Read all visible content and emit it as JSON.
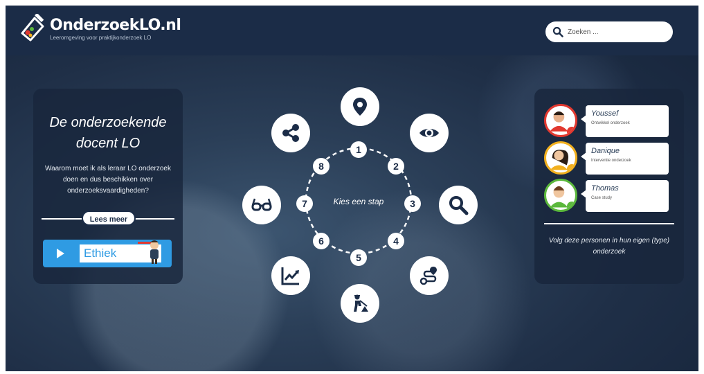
{
  "header": {
    "logo_title": "OnderzoekLO.nl",
    "logo_tagline": "Leeromgeving voor praktijkonderzoek LO",
    "search_placeholder": "Zoeken ..."
  },
  "left_panel": {
    "title_line1": "De onderzoekende",
    "title_line2": "docent LO",
    "body": "Waarom moet ik als leraar LO onderzoek doen en dus beschikken over onderzoeksvaardigheden?",
    "more_label": "Lees meer",
    "video_label": "Ethiek"
  },
  "wheel": {
    "center_label": "Kies een stap",
    "steps": [
      "1",
      "2",
      "3",
      "4",
      "5",
      "6",
      "7",
      "8"
    ],
    "icons": [
      "location-pin-icon",
      "eye-icon",
      "search-icon",
      "route-icon",
      "construction-worker-icon",
      "trend-chart-icon",
      "glasses-icon",
      "share-icon"
    ]
  },
  "right_panel": {
    "people": [
      {
        "name": "Youssef",
        "role": "Ontwikkel onderzoek",
        "color": "#e2382f"
      },
      {
        "name": "Danique",
        "role": "Interventie onderzoek",
        "color": "#f2b01e"
      },
      {
        "name": "Thomas",
        "role": "Case study",
        "color": "#5bb83c"
      }
    ],
    "footer_text": "Volg deze personen in hun eigen (type) onderzoek"
  },
  "colors": {
    "navy": "#1b2c47",
    "accent_blue": "#2f9be3"
  }
}
